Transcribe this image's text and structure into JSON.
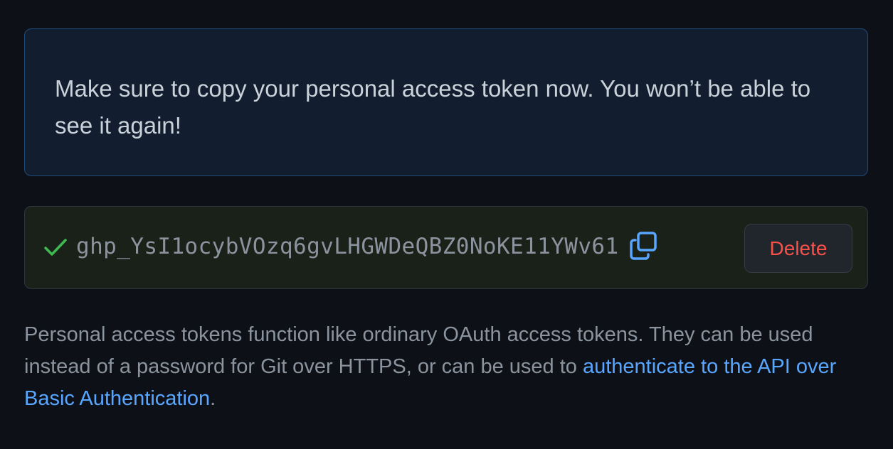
{
  "flash": {
    "message": "Make sure to copy your personal access token now. You won’t be able to see it again!"
  },
  "token": {
    "value": "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",
    "status_icon": "check-icon",
    "copy_icon": "copy-icon",
    "delete_label": "Delete"
  },
  "description": {
    "text_before": "Personal access tokens function like ordinary OAuth access tokens. They can be used instead of a password for Git over HTTPS, or can be used to ",
    "link_text": "authenticate to the API over Basic Authentication",
    "text_after": "."
  },
  "colors": {
    "background": "#0d1117",
    "flash_background": "#121d2f",
    "flash_border": "#1f4a7a",
    "success": "#3fb950",
    "danger": "#f85149",
    "link": "#58a6ff",
    "muted_text": "#8b949e"
  }
}
